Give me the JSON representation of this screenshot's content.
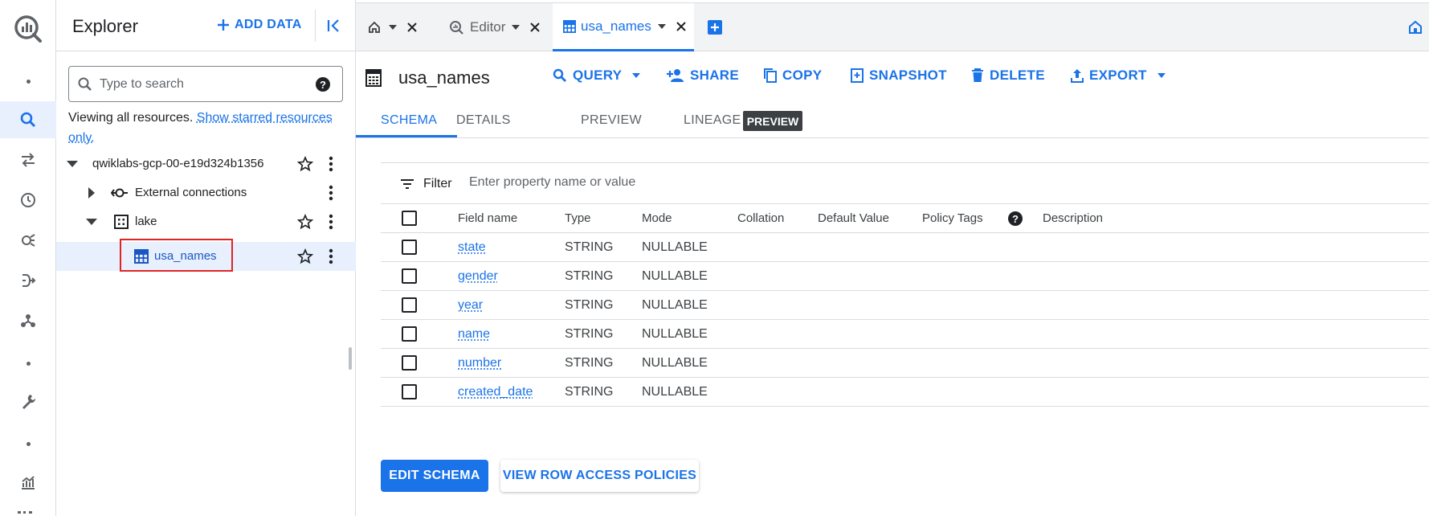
{
  "explorer": {
    "title": "Explorer",
    "add_data": "ADD DATA",
    "search_placeholder": "Type to search",
    "viewing_text": "Viewing all resources.",
    "starred_link": "Show starred resources only.",
    "tree": [
      {
        "label": "qwiklabs-gcp-00-e19d324b1356"
      },
      {
        "label": "External connections"
      },
      {
        "label": "lake"
      },
      {
        "label": "usa_names"
      }
    ]
  },
  "tabs": {
    "editor": "Editor",
    "table": "usa_names"
  },
  "toolbar": {
    "title": "usa_names",
    "query": "QUERY",
    "share": "SHARE",
    "copy": "COPY",
    "snapshot": "SNAPSHOT",
    "delete": "DELETE",
    "export": "EXPORT"
  },
  "subtabs": {
    "schema": "SCHEMA",
    "details": "DETAILS",
    "preview": "PREVIEW",
    "lineage": "LINEAGE",
    "lineage_badge": "PREVIEW"
  },
  "filter": {
    "label": "Filter",
    "placeholder": "Enter property name or value"
  },
  "table": {
    "headers": [
      "Field name",
      "Type",
      "Mode",
      "Collation",
      "Default Value",
      "Policy Tags",
      "Description"
    ],
    "rows": [
      {
        "field": "state",
        "type": "STRING",
        "mode": "NULLABLE"
      },
      {
        "field": "gender",
        "type": "STRING",
        "mode": "NULLABLE"
      },
      {
        "field": "year",
        "type": "STRING",
        "mode": "NULLABLE"
      },
      {
        "field": "name",
        "type": "STRING",
        "mode": "NULLABLE"
      },
      {
        "field": "number",
        "type": "STRING",
        "mode": "NULLABLE"
      },
      {
        "field": "created_date",
        "type": "STRING",
        "mode": "NULLABLE"
      }
    ]
  },
  "buttons": {
    "edit_schema": "EDIT SCHEMA",
    "row_access": "VIEW ROW ACCESS POLICIES"
  },
  "colors": {
    "accent": "#1a73e8",
    "selected_bg": "#e8f0fe",
    "highlight": "#e02424"
  }
}
